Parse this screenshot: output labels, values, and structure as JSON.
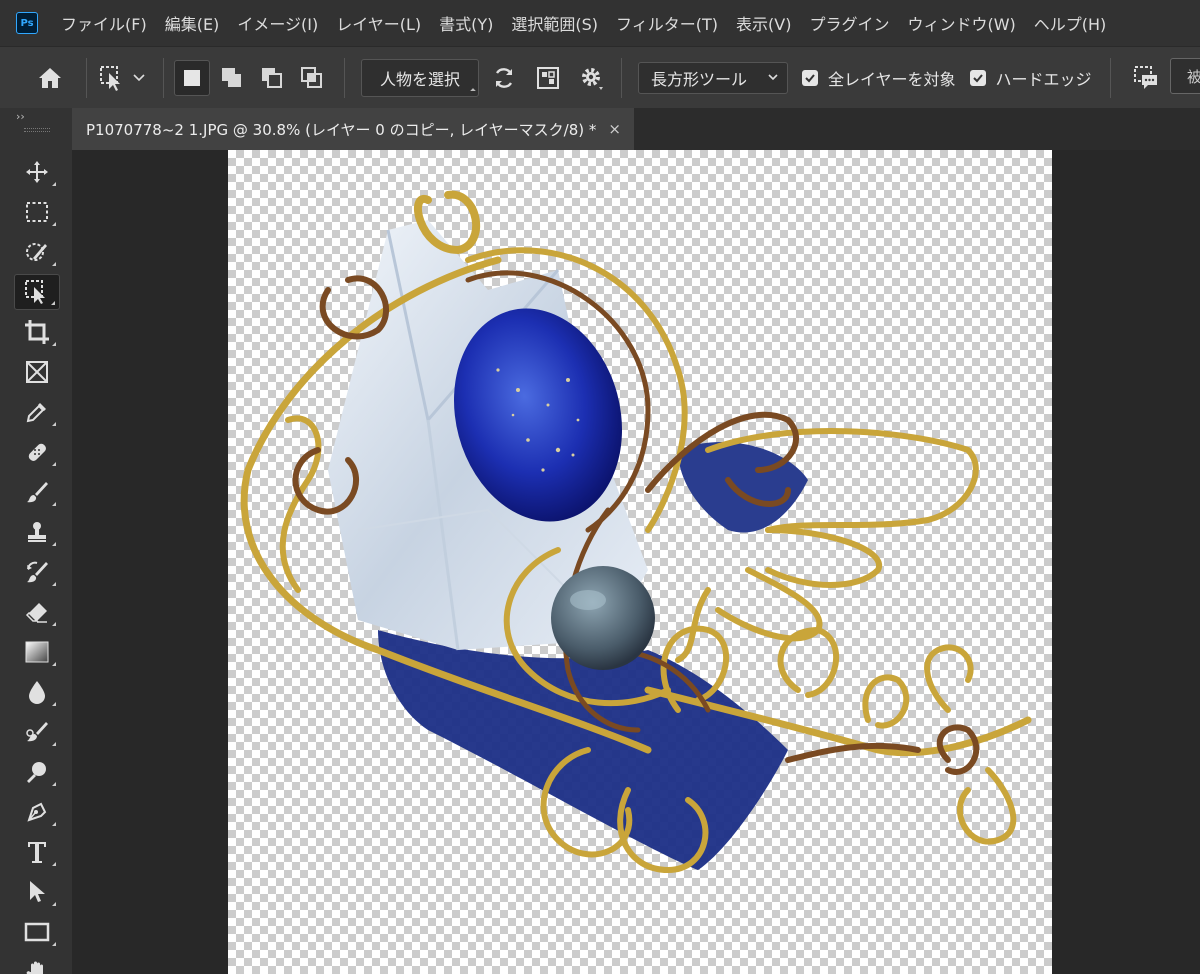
{
  "app": {
    "logo_text": "Ps",
    "menu": [
      "ファイル(F)",
      "編集(E)",
      "イメージ(I)",
      "レイヤー(L)",
      "書式(Y)",
      "選択範囲(S)",
      "フィルター(T)",
      "表示(V)",
      "プラグイン",
      "ウィンドウ(W)",
      "ヘルプ(H)"
    ]
  },
  "options_bar": {
    "select_subject_label": "人物を選択",
    "tool_mode_value": "長方形ツール",
    "sample_all_layers_label": "全レイヤーを対象",
    "sample_all_layers_checked": true,
    "hard_edge_label": "ハードエッジ",
    "hard_edge_checked": true,
    "cut_off_field_text": "被"
  },
  "toolbar": {
    "collapse_glyph": "››",
    "tools": [
      "move-tool",
      "rectangular-marquee-tool",
      "quick-selection-tool",
      "object-selection-tool",
      "crop-tool",
      "frame-tool",
      "eyedropper-tool",
      "spot-healing-brush-tool",
      "brush-tool",
      "clone-stamp-tool",
      "history-brush-tool",
      "eraser-tool",
      "gradient-tool",
      "blur-tool",
      "smudge-tool",
      "dodge-tool",
      "pen-tool",
      "type-tool",
      "path-selection-tool",
      "rectangle-tool",
      "hand-tool"
    ],
    "active_tool": "object-selection-tool"
  },
  "document": {
    "tab_title": "P1070778~2 1.JPG @ 30.8% (レイヤー 0 のコピー, レイヤーマスク/8) *",
    "close_glyph": "×",
    "zoom": "30.8%"
  },
  "colors": {
    "accent": "#31a8ff",
    "app_bg": "#282828",
    "menubar_bg": "#323232",
    "panel_bg": "#3a3a3a",
    "lapis_blue": "#1a2fb5",
    "gold_wire": "#c9a53a",
    "copper_wire": "#7a4a22"
  }
}
